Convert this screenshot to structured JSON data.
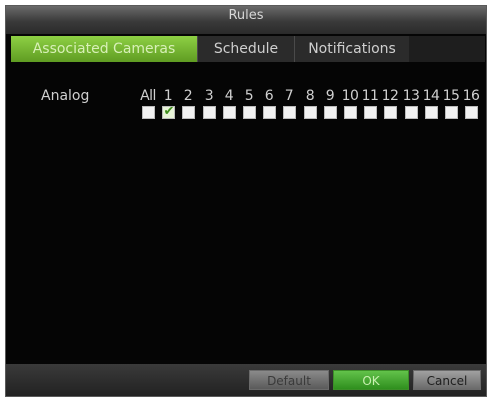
{
  "window": {
    "title": "Rules"
  },
  "tabs": [
    {
      "label": "Associated Cameras",
      "active": true
    },
    {
      "label": "Schedule",
      "active": false
    },
    {
      "label": "Notifications",
      "active": false
    }
  ],
  "cameras": {
    "row_label": "Analog",
    "all_label": "All",
    "numbers": [
      "1",
      "2",
      "3",
      "4",
      "5",
      "6",
      "7",
      "8",
      "9",
      "10",
      "11",
      "12",
      "13",
      "14",
      "15",
      "16"
    ],
    "all_checked": false,
    "checked": [
      true,
      false,
      false,
      false,
      false,
      false,
      false,
      false,
      false,
      false,
      false,
      false,
      false,
      false,
      false,
      false
    ]
  },
  "buttons": {
    "default_label": "Default",
    "ok_label": "OK",
    "cancel_label": "Cancel"
  },
  "colors": {
    "accent_green": "#7cc242",
    "background": "#050505"
  }
}
